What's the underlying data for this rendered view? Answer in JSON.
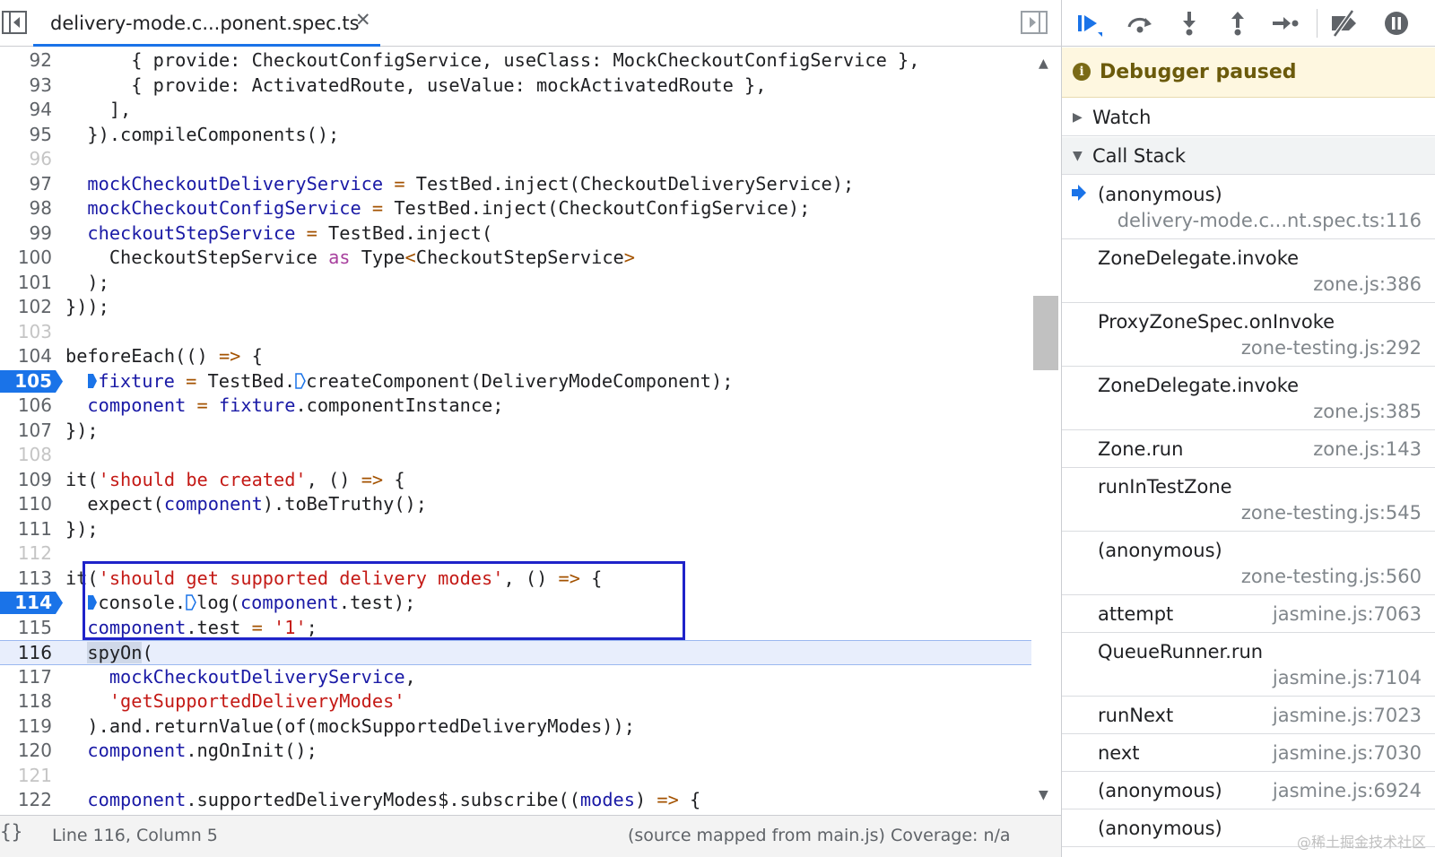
{
  "editor": {
    "tab": {
      "filename": "delivery-mode.c...ponent.spec.ts",
      "close_glyph": "✕"
    },
    "lines": [
      {
        "n": "92",
        "dim": false,
        "parts": [
          [
            "t",
            "      { provide: CheckoutConfigService, useClass: MockCheckoutConfigService },"
          ]
        ]
      },
      {
        "n": "93",
        "dim": false,
        "parts": [
          [
            "t",
            "      { provide: ActivatedRoute, useValue: mockActivatedRoute },"
          ]
        ]
      },
      {
        "n": "94",
        "dim": false,
        "parts": [
          [
            "t",
            "    ],"
          ]
        ]
      },
      {
        "n": "95",
        "dim": false,
        "parts": [
          [
            "t",
            "  }).compileComponents();"
          ]
        ]
      },
      {
        "n": "96",
        "dim": true,
        "parts": []
      },
      {
        "n": "97",
        "dim": false,
        "parts": [
          [
            "t",
            "  "
          ],
          [
            "var",
            "mockCheckoutDeliveryService"
          ],
          [
            "op",
            " ="
          ],
          [
            "t",
            " TestBed.inject(CheckoutDeliveryService);"
          ]
        ]
      },
      {
        "n": "98",
        "dim": false,
        "parts": [
          [
            "t",
            "  "
          ],
          [
            "var",
            "mockCheckoutConfigService"
          ],
          [
            "op",
            " ="
          ],
          [
            "t",
            " TestBed.inject(CheckoutConfigService);"
          ]
        ]
      },
      {
        "n": "99",
        "dim": false,
        "parts": [
          [
            "t",
            "  "
          ],
          [
            "var",
            "checkoutStepService"
          ],
          [
            "op",
            " ="
          ],
          [
            "t",
            " TestBed.inject("
          ]
        ]
      },
      {
        "n": "100",
        "dim": false,
        "parts": [
          [
            "t",
            "    CheckoutStepService "
          ],
          [
            "kw",
            "as"
          ],
          [
            "t",
            " Type"
          ],
          [
            "op",
            "<"
          ],
          [
            "t",
            "CheckoutStepService"
          ],
          [
            "op",
            ">"
          ]
        ]
      },
      {
        "n": "101",
        "dim": false,
        "parts": [
          [
            "t",
            "  );"
          ]
        ]
      },
      {
        "n": "102",
        "dim": false,
        "parts": [
          [
            "t",
            "}));"
          ]
        ]
      },
      {
        "n": "103",
        "dim": true,
        "parts": []
      },
      {
        "n": "104",
        "dim": false,
        "parts": [
          [
            "t",
            "beforeEach(() "
          ],
          [
            "op",
            "=>"
          ],
          [
            "t",
            " {"
          ]
        ]
      },
      {
        "n": "105",
        "dim": false,
        "bp": true,
        "parts": [
          [
            "t",
            "  "
          ],
          [
            "bp",
            ""
          ],
          [
            "var",
            "fixture"
          ],
          [
            "op",
            " ="
          ],
          [
            "t",
            " TestBed."
          ],
          [
            "bpo",
            ""
          ],
          [
            "t",
            "createComponent(DeliveryModeComponent);"
          ]
        ]
      },
      {
        "n": "106",
        "dim": false,
        "parts": [
          [
            "t",
            "  "
          ],
          [
            "var",
            "component"
          ],
          [
            "op",
            " ="
          ],
          [
            "t",
            " "
          ],
          [
            "var",
            "fixture"
          ],
          [
            "t",
            ".componentInstance;"
          ]
        ]
      },
      {
        "n": "107",
        "dim": false,
        "parts": [
          [
            "t",
            "});"
          ]
        ]
      },
      {
        "n": "108",
        "dim": true,
        "parts": []
      },
      {
        "n": "109",
        "dim": false,
        "parts": [
          [
            "t",
            "it("
          ],
          [
            "str",
            "'should be created'"
          ],
          [
            "t",
            ", () "
          ],
          [
            "op",
            "=>"
          ],
          [
            "t",
            " {"
          ]
        ]
      },
      {
        "n": "110",
        "dim": false,
        "parts": [
          [
            "t",
            "  expect("
          ],
          [
            "var",
            "component"
          ],
          [
            "t",
            ").toBeTruthy();"
          ]
        ]
      },
      {
        "n": "111",
        "dim": false,
        "parts": [
          [
            "t",
            "});"
          ]
        ]
      },
      {
        "n": "112",
        "dim": true,
        "parts": []
      },
      {
        "n": "113",
        "dim": false,
        "parts": [
          [
            "t",
            "it("
          ],
          [
            "str",
            "'should get supported delivery modes'"
          ],
          [
            "t",
            ", () "
          ],
          [
            "op",
            "=>"
          ],
          [
            "t",
            " {"
          ]
        ]
      },
      {
        "n": "114",
        "dim": false,
        "bp": true,
        "parts": [
          [
            "t",
            "  "
          ],
          [
            "bp",
            ""
          ],
          [
            "t",
            "console."
          ],
          [
            "bpo",
            ""
          ],
          [
            "t",
            "log("
          ],
          [
            "var",
            "component"
          ],
          [
            "t",
            ".test);"
          ]
        ]
      },
      {
        "n": "115",
        "dim": false,
        "parts": [
          [
            "t",
            "  "
          ],
          [
            "var",
            "component"
          ],
          [
            "t",
            ".test "
          ],
          [
            "op",
            "="
          ],
          [
            "t",
            " "
          ],
          [
            "str",
            "'1'"
          ],
          [
            "t",
            ";"
          ]
        ]
      },
      {
        "n": "116",
        "dim": false,
        "exec": true,
        "parts": [
          [
            "t",
            "  "
          ],
          [
            "hl",
            "spyOn"
          ],
          [
            "t",
            "("
          ]
        ]
      },
      {
        "n": "117",
        "dim": false,
        "parts": [
          [
            "t",
            "    "
          ],
          [
            "var",
            "mockCheckoutDeliveryService"
          ],
          [
            "t",
            ","
          ]
        ]
      },
      {
        "n": "118",
        "dim": false,
        "parts": [
          [
            "t",
            "    "
          ],
          [
            "str",
            "'getSupportedDeliveryModes'"
          ]
        ]
      },
      {
        "n": "119",
        "dim": false,
        "parts": [
          [
            "t",
            "  ).and.returnValue(of(mockSupportedDeliveryModes));"
          ]
        ]
      },
      {
        "n": "120",
        "dim": false,
        "parts": [
          [
            "t",
            "  "
          ],
          [
            "var",
            "component"
          ],
          [
            "t",
            ".ngOnInit();"
          ]
        ]
      },
      {
        "n": "121",
        "dim": true,
        "parts": []
      },
      {
        "n": "122",
        "dim": false,
        "parts": [
          [
            "t",
            "  "
          ],
          [
            "var",
            "component"
          ],
          [
            "t",
            ".supportedDeliveryModes$.subscribe(("
          ],
          [
            "var",
            "modes"
          ],
          [
            "t",
            ") "
          ],
          [
            "op",
            "=>"
          ],
          [
            "t",
            " {"
          ]
        ]
      }
    ],
    "status": {
      "pretty_print": "{}",
      "cursor": "Line 116, Column 5",
      "source_map": "(source mapped from main.js) Coverage: n/a"
    }
  },
  "debugger": {
    "paused_label": "Debugger paused",
    "paused_icon": "i",
    "watch_label": "Watch",
    "call_stack_label": "Call Stack",
    "frames": [
      {
        "name": "(anonymous)",
        "location": "delivery-mode.c...nt.spec.ts:116",
        "two_line": true,
        "current": true
      },
      {
        "name": "ZoneDelegate.invoke",
        "location": "zone.js:386",
        "two_line": true
      },
      {
        "name": "ProxyZoneSpec.onInvoke",
        "location": "zone-testing.js:292",
        "two_line": true
      },
      {
        "name": "ZoneDelegate.invoke",
        "location": "zone.js:385",
        "two_line": true
      },
      {
        "name": "Zone.run",
        "location": "zone.js:143",
        "two_line": false
      },
      {
        "name": "runInTestZone",
        "location": "zone-testing.js:545",
        "two_line": true
      },
      {
        "name": "(anonymous)",
        "location": "zone-testing.js:560",
        "two_line": true
      },
      {
        "name": "attempt",
        "location": "jasmine.js:7063",
        "two_line": false
      },
      {
        "name": "QueueRunner.run",
        "location": "jasmine.js:7104",
        "two_line": true
      },
      {
        "name": "runNext",
        "location": "jasmine.js:7023",
        "two_line": false
      },
      {
        "name": "next",
        "location": "jasmine.js:7030",
        "two_line": false
      },
      {
        "name": "(anonymous)",
        "location": "jasmine.js:6924",
        "two_line": false
      },
      {
        "name": "(anonymous)",
        "location": "",
        "two_line": false
      }
    ],
    "watermark": "@稀土掘金技术社区"
  },
  "colors": {
    "accent": "#1a73e8",
    "breakpoint": "#1a73e8",
    "selection_box": "#1f23c9",
    "paused_banner": "#fef7e0"
  },
  "icons": {
    "toolbar": [
      "resume-icon",
      "step-over-icon",
      "step-into-icon",
      "step-out-icon",
      "step-icon",
      "deactivate-breakpoints-icon",
      "pause-on-exceptions-icon"
    ],
    "current_frame": "arrow-right-icon"
  }
}
